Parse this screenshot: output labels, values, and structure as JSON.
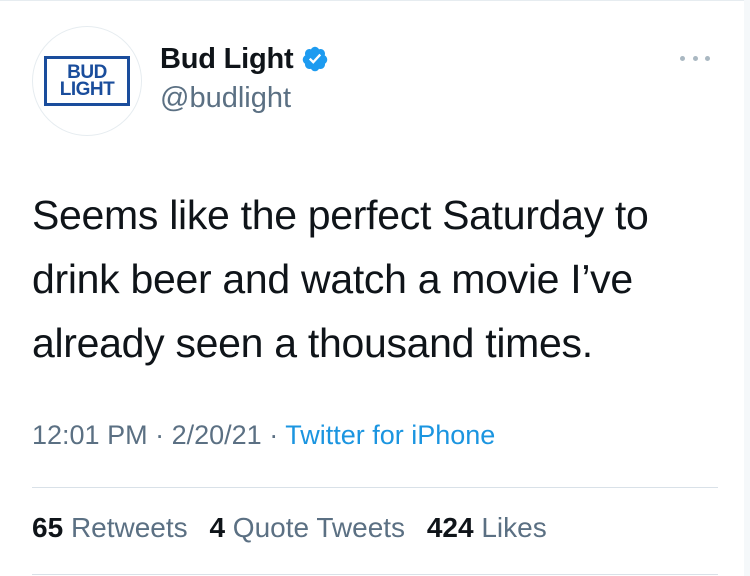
{
  "tweet": {
    "author": {
      "display_name": "Bud Light",
      "handle": "@budlight",
      "verified": true,
      "avatar_logo": {
        "line1": "BUD",
        "line2": "LIGHT",
        "color": "#1a4d9c"
      }
    },
    "more_icon": "more-horizontal-icon",
    "verified_icon": "verified-badge-icon",
    "text_lines": [
      "Seems like the perfect Saturday to",
      "drink beer and watch a movie I’ve",
      "already seen a thousand times."
    ],
    "meta": {
      "time": "12:01 PM",
      "separator": "·",
      "date": "2/20/21",
      "source": "Twitter for iPhone"
    },
    "stats": {
      "retweets_count": "65",
      "retweets_label": "Retweets",
      "quotes_count": "4",
      "quotes_label": "Quote Tweets",
      "likes_count": "424",
      "likes_label": "Likes"
    }
  },
  "colors": {
    "text": "#0f1419",
    "secondary": "#5b7083",
    "link": "#1b95e0",
    "verified": "#1d9bf0",
    "divider": "#d9e1e8"
  }
}
